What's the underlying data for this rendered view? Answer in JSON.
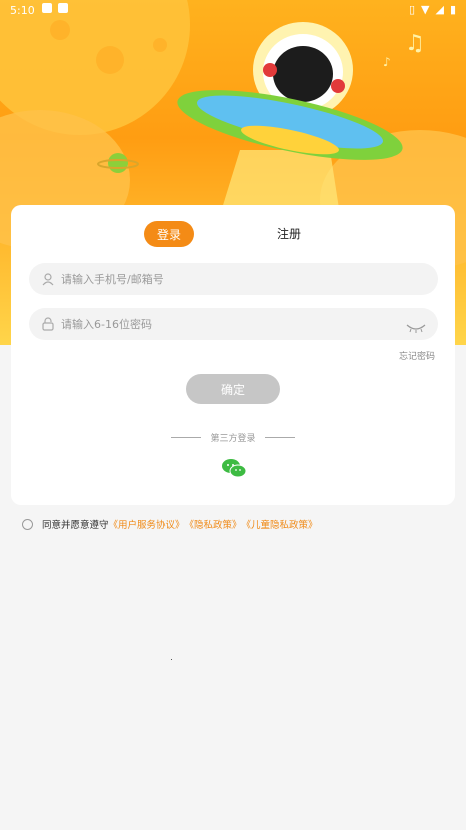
{
  "statusbar": {
    "time": "5:10"
  },
  "tabs": {
    "login": "登录",
    "register": "注册"
  },
  "fields": {
    "account_placeholder": "请输入手机号/邮箱号",
    "password_placeholder": "请输入6-16位密码"
  },
  "links": {
    "forgot": "忘记密码"
  },
  "buttons": {
    "confirm": "确定"
  },
  "third_party": {
    "label": "第三方登录"
  },
  "agreement": {
    "prefix": "同意并愿意遵守",
    "user_agreement": "《用户服务协议》",
    "privacy": "《隐私政策》",
    "child_privacy": "《儿童隐私政策》"
  },
  "colors": {
    "accent": "#f48b16",
    "hero_top": "#ffb21e",
    "wechat": "#3dbb42"
  }
}
